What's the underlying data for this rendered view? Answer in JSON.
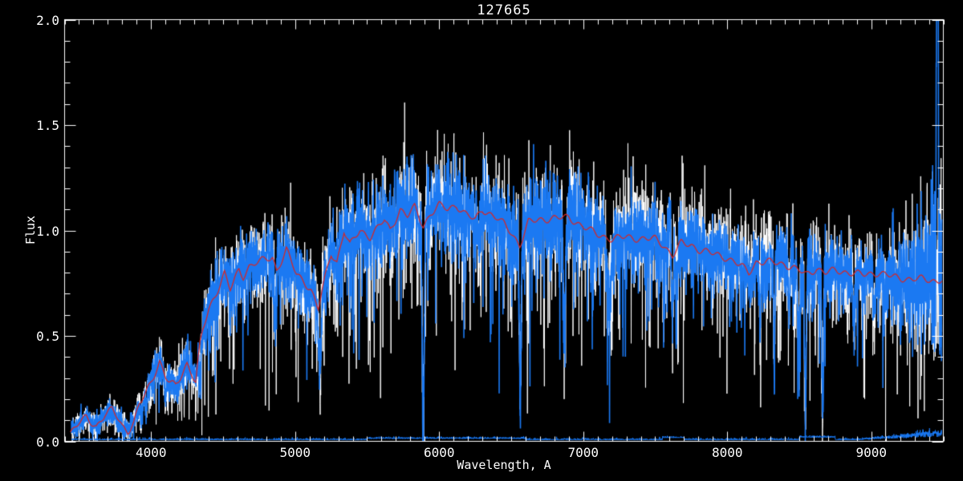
{
  "title": "127665",
  "colors": {
    "background": "#000000",
    "axis": "#ffffff",
    "observed": "#ffffff",
    "processed": "#1b79f2",
    "model": "#d42828"
  },
  "axes": {
    "xlabel": "Wavelength, A",
    "ylabel": "Flux",
    "xlim": [
      3400,
      9500
    ],
    "ylim": [
      0.0,
      2.0
    ],
    "xticks": [
      4000,
      5000,
      6000,
      7000,
      8000,
      9000
    ],
    "xtick_labels": [
      "4000",
      "5000",
      "6000",
      "7000",
      "8000",
      "9000"
    ],
    "x_minor_step": 100,
    "yticks": [
      0.0,
      0.5,
      1.0,
      1.5,
      2.0
    ],
    "ytick_labels": [
      "0.0",
      "0.5",
      "1.0",
      "1.5",
      "2.0"
    ],
    "y_minor_step": 0.1,
    "grid": false
  },
  "chart_data": {
    "type": "line",
    "title": "127665",
    "xlabel": "Wavelength, A",
    "ylabel": "Flux",
    "xlim": [
      3400,
      9500
    ],
    "ylim": [
      0.0,
      2.0
    ],
    "x_data_range": [
      3448,
      9490
    ],
    "legend": "none",
    "series": [
      {
        "name": "observed-spectrum",
        "color": "#ffffff",
        "style": "noisy"
      },
      {
        "name": "processed-spectrum",
        "color": "#1b79f2",
        "style": "noisy"
      },
      {
        "name": "model-fit",
        "color": "#d42828",
        "style": "smooth"
      },
      {
        "name": "error-spectrum",
        "color": "#1b79f2",
        "style": "baseline-near-zero"
      }
    ],
    "model_points": {
      "x": [
        3420,
        3450,
        3500,
        3550,
        3580,
        3620,
        3680,
        3730,
        3760,
        3800,
        3840,
        3880,
        3920,
        3960,
        4000,
        4030,
        4060,
        4100,
        4130,
        4170,
        4210,
        4250,
        4280,
        4310,
        4340,
        4360,
        4400,
        4450,
        4510,
        4550,
        4610,
        4640,
        4680,
        4730,
        4790,
        4844,
        4872,
        4940,
        5010,
        5060,
        5110,
        5160,
        5210,
        5250,
        5290,
        5340,
        5380,
        5450,
        5520,
        5620,
        5660,
        5730,
        5780,
        5830,
        5890,
        5940,
        6000,
        6060,
        6120,
        6180,
        6250,
        6300,
        6350,
        6400,
        6450,
        6500,
        6560,
        6620,
        6700,
        6800,
        6900,
        7000,
        7100,
        7200,
        7300,
        7400,
        7500,
        7560,
        7620,
        7680,
        7750,
        7800,
        7900,
        8000,
        8100,
        8150,
        8200,
        8300,
        8400,
        8500,
        8550,
        8620,
        8680,
        8750,
        8850,
        8950,
        9050,
        9150,
        9250,
        9350,
        9450,
        9490
      ],
      "y": [
        0.03,
        0.05,
        0.09,
        0.11,
        0.09,
        0.07,
        0.13,
        0.15,
        0.12,
        0.07,
        0.05,
        0.09,
        0.18,
        0.22,
        0.28,
        0.33,
        0.38,
        0.31,
        0.28,
        0.26,
        0.31,
        0.37,
        0.33,
        0.28,
        0.46,
        0.53,
        0.62,
        0.7,
        0.8,
        0.72,
        0.81,
        0.78,
        0.83,
        0.85,
        0.86,
        0.87,
        0.81,
        0.91,
        0.79,
        0.76,
        0.72,
        0.63,
        0.78,
        0.89,
        0.85,
        1.0,
        0.93,
        1.0,
        0.97,
        1.05,
        1.0,
        1.1,
        1.07,
        1.11,
        1.02,
        1.08,
        1.12,
        1.1,
        1.12,
        1.08,
        1.05,
        1.1,
        1.08,
        1.06,
        1.03,
        0.99,
        0.93,
        1.04,
        1.05,
        1.06,
        1.06,
        1.02,
        0.98,
        0.96,
        0.97,
        0.96,
        0.96,
        0.93,
        0.88,
        0.94,
        0.93,
        0.91,
        0.89,
        0.87,
        0.83,
        0.8,
        0.85,
        0.85,
        0.84,
        0.81,
        0.79,
        0.82,
        0.8,
        0.81,
        0.8,
        0.79,
        0.8,
        0.78,
        0.77,
        0.77,
        0.76,
        0.77
      ]
    },
    "absorption_lines": [
      {
        "wavelength": 3934,
        "depth": 0.45,
        "width": 6
      },
      {
        "wavelength": 3968,
        "depth": 0.35,
        "width": 5
      },
      {
        "wavelength": 4101,
        "depth": 0.25,
        "width": 6
      },
      {
        "wavelength": 4340,
        "depth": 0.22,
        "width": 6
      },
      {
        "wavelength": 4861,
        "depth": 0.3,
        "width": 7
      },
      {
        "wavelength": 5172,
        "depth": 0.45,
        "width": 9
      },
      {
        "wavelength": 5890,
        "depth": 0.88,
        "width": 7
      },
      {
        "wavelength": 6277,
        "depth": 0.18,
        "width": 6
      },
      {
        "wavelength": 6563,
        "depth": 0.82,
        "width": 6
      },
      {
        "wavelength": 6870,
        "depth": 0.42,
        "width": 9
      },
      {
        "wavelength": 7180,
        "depth": 0.3,
        "width": 12
      },
      {
        "wavelength": 7621,
        "depth": 0.25,
        "width": 9
      },
      {
        "wavelength": 7650,
        "depth": 0.15,
        "width": 8
      },
      {
        "wavelength": 8228,
        "depth": 0.28,
        "width": 6
      },
      {
        "wavelength": 8327,
        "depth": 0.5,
        "width": 5
      },
      {
        "wavelength": 8430,
        "depth": 0.25,
        "width": 6
      },
      {
        "wavelength": 8498,
        "depth": 0.42,
        "width": 6
      },
      {
        "wavelength": 8542,
        "depth": 0.8,
        "width": 6
      },
      {
        "wavelength": 8662,
        "depth": 0.78,
        "width": 6
      },
      {
        "wavelength": 8880,
        "depth": 0.32,
        "width": 7
      },
      {
        "wavelength": 9020,
        "depth": 0.25,
        "width": 6
      },
      {
        "wavelength": 9100,
        "depth": 0.22,
        "width": 6
      }
    ],
    "emission_features": [
      {
        "wavelength": 7598,
        "height": 0.18,
        "width": 6,
        "series": "both"
      },
      {
        "wavelength": 9390,
        "height": 0.22,
        "width": 4,
        "series": "observed"
      },
      {
        "wavelength": 9455,
        "height": 1.4,
        "width": 4,
        "series": "processed"
      },
      {
        "wavelength": 9463,
        "height": 1.2,
        "width": 3,
        "series": "processed"
      }
    ],
    "noise": {
      "base": 0.02,
      "scale_with_flux": 0.08,
      "downward_spike_prob_blue": 0.05,
      "downward_spike_prob_white": 0.09,
      "red_end_boost_start": 9100,
      "white_offset_region": [
        7250,
        8450
      ],
      "white_offset": 0.035
    },
    "error_spectrum_level": 0.01
  }
}
